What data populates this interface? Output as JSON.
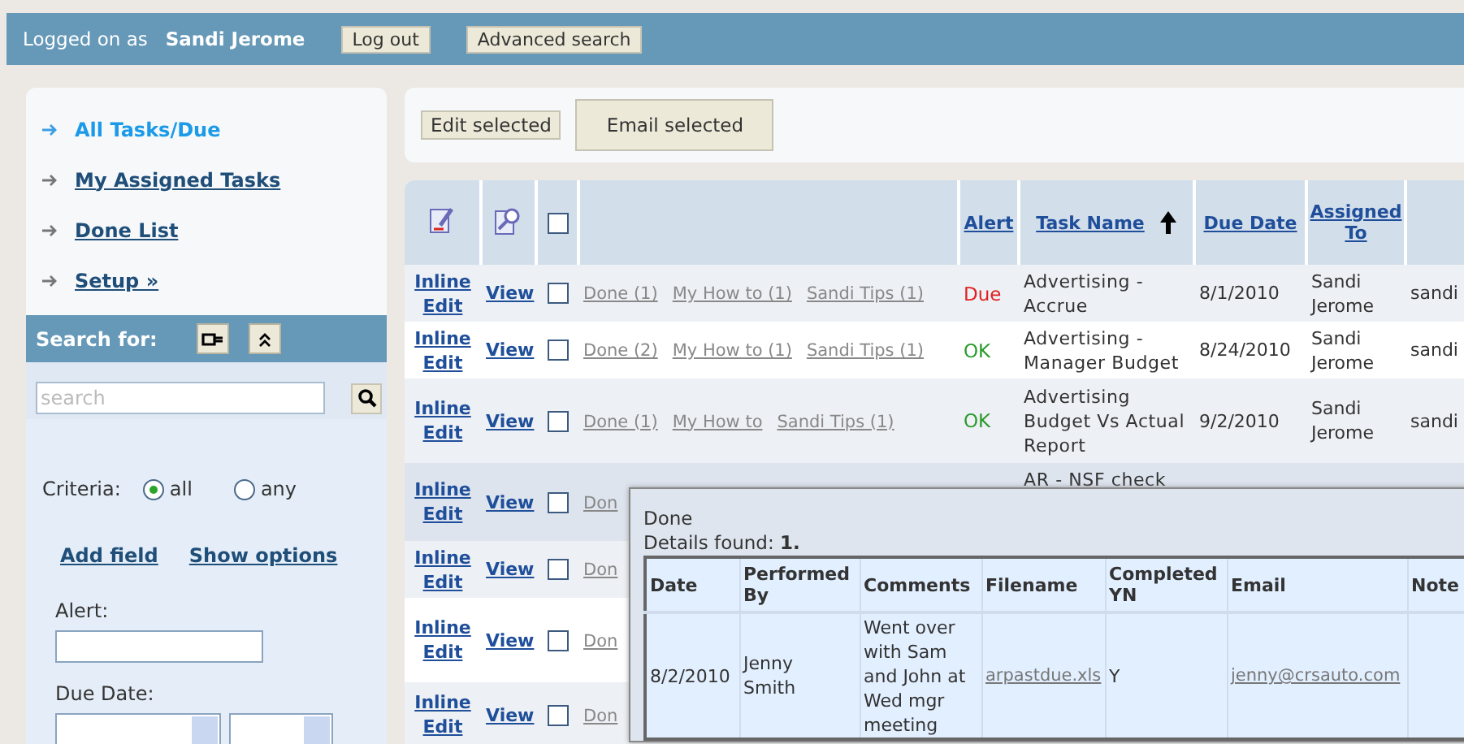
{
  "header": {
    "logged_label": "Logged on as",
    "user": "Sandi Jerome",
    "buttons": [
      "Log out",
      "Advanced search"
    ]
  },
  "sidebar": {
    "items": [
      {
        "label": "All Tasks/Due",
        "selected": true
      },
      {
        "label": "My Assigned Tasks",
        "selected": false
      },
      {
        "label": "Done List",
        "selected": false
      },
      {
        "label": "Setup »",
        "selected": false
      }
    ],
    "search": {
      "label": "Search for:",
      "placeholder": "search"
    },
    "criteria": {
      "label": "Criteria:",
      "options": [
        {
          "label": "all",
          "selected": true
        },
        {
          "label": "any",
          "selected": false
        }
      ]
    },
    "links": [
      "Add field",
      "Show options"
    ],
    "fields": [
      {
        "label": "Alert:",
        "kind": "text"
      },
      {
        "label": "Due Date:",
        "kind": "date"
      }
    ]
  },
  "toolbar": {
    "buttons": [
      "Edit selected",
      "Email selected"
    ]
  },
  "table": {
    "select_all_checked": false,
    "columns": [
      {
        "label": "Alert",
        "sorted": false
      },
      {
        "label": "Task Name",
        "sorted": true
      },
      {
        "label": "Due Date",
        "sorted": false
      },
      {
        "label": "Assigned To",
        "sorted": false
      }
    ],
    "rows": [
      {
        "edit": "Inline Edit",
        "view": "View",
        "checked": false,
        "highlighted": false,
        "links": [
          "Done (1)",
          "My How to (1)",
          "Sandi Tips (1)"
        ],
        "alert": "Due",
        "color": "#e02020",
        "task": "Advertising - Accrue",
        "due": "8/1/2010",
        "assigned": "Sandi Jerome",
        "column_9": "sandi"
      },
      {
        "edit": "Inline Edit",
        "view": "View",
        "checked": false,
        "highlighted": false,
        "links": [
          "Done (2)",
          "My How to (1)",
          "Sandi Tips (1)"
        ],
        "alert": "OK",
        "color": "#2a9a2a",
        "task": "Advertising - Manager Budget",
        "due": "8/24/2010",
        "assigned": "Sandi Jerome",
        "column_9": "sandi"
      },
      {
        "edit": "Inline Edit",
        "view": "View",
        "checked": false,
        "highlighted": false,
        "links": [
          "Done (1)",
          "My How to",
          "Sandi Tips (1)"
        ],
        "alert": "OK",
        "color": "#2a9a2a",
        "task": "Advertising Budget Vs Actual Report",
        "due": "9/2/2010",
        "assigned": "Sandi Jerome",
        "column_9": "sandi"
      },
      {
        "edit": "Inline Edit",
        "view": "View",
        "checked": false,
        "highlighted": true,
        "links": [
          "Don"
        ],
        "task": "AR - NSF check"
      },
      {
        "edit": "Inline Edit",
        "view": "View",
        "checked": false,
        "highlighted": false,
        "links": [
          "Don"
        ]
      },
      {
        "edit": "Inline Edit",
        "view": "View",
        "checked": false,
        "highlighted": false,
        "links": [
          "Don"
        ]
      },
      {
        "edit": "Inline Edit",
        "view": "View",
        "checked": false,
        "highlighted": false,
        "links": [
          "Don"
        ]
      }
    ]
  },
  "popup": {
    "title": "Done",
    "found": "Details found: **1.**",
    "columns": [
      "Date",
      "Performed By",
      "Comments",
      "Filename",
      "Completed YN",
      "Email",
      "Note"
    ],
    "rows": [
      {
        "date": "8/2/2010",
        "performed_by": "Jenny Smith",
        "comments": "Went over with Sam and John at Wed mgr meeting",
        "filename": "arpastdue.xls",
        "completed": "Y",
        "email": "jenny@crsauto.com"
      }
    ]
  }
}
